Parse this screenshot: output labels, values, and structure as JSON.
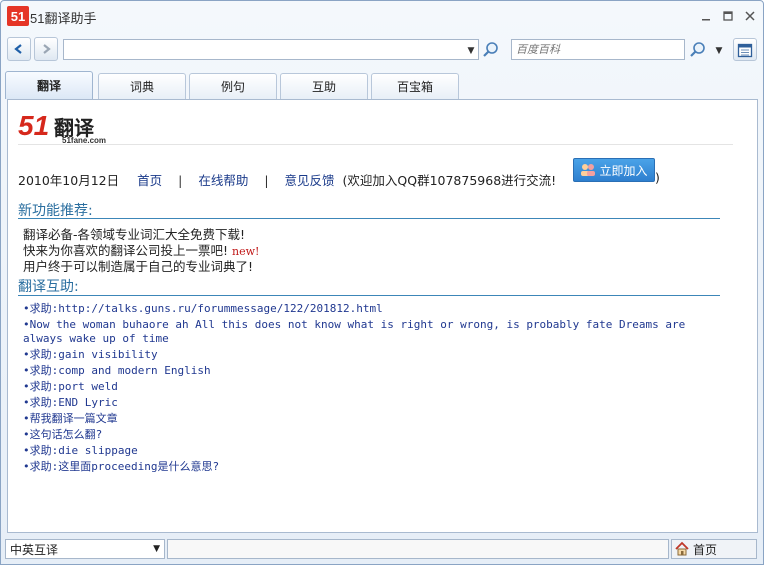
{
  "window": {
    "logo_text": "51",
    "title": "51翻译助手",
    "minimize_icon": "minimize-icon",
    "maximize_icon": "maximize-icon",
    "close_icon": "close-icon"
  },
  "toolbar": {
    "url_value": "",
    "search_placeholder": "百度百科"
  },
  "tabs": [
    {
      "label": "翻译",
      "active": true
    },
    {
      "label": "词典",
      "active": false
    },
    {
      "label": "例句",
      "active": false
    },
    {
      "label": "互助",
      "active": false
    },
    {
      "label": "百宝箱",
      "active": false
    }
  ],
  "brand": {
    "number": "51",
    "name": "翻译",
    "url": "51fane.com"
  },
  "info": {
    "date": "2010年10月12日",
    "home": "首页",
    "sep1": "|",
    "help": "在线帮助",
    "sep2": "|",
    "feedback": "意见反馈",
    "qq_text": "(欢迎加入QQ群107875968进行交流!",
    "join_button": "立即加入",
    "close_paren": ")"
  },
  "features": {
    "title": "新功能推荐:",
    "items": [
      "翻译必备-各领域专业词汇大全免费下载!",
      "快来为你喜欢的翻译公司投上一票吧!",
      "用户终于可以制造属于自己的专业词典了!"
    ],
    "new_tag": "new!"
  },
  "help": {
    "title": "翻译互助:",
    "items": [
      "•求助:http://talks.guns.ru/forummessage/122/201812.html",
      "•Now the woman buhaore ah All this does not know what is right or wrong, is probably fate Dreams are always wake up of time",
      "•求助:gain visibility",
      "•求助:comp and modern English",
      "•求助:port weld",
      "•求助:END Lyric",
      "•帮我翻译一篇文章",
      "•这句话怎么翻?",
      "•求助:die slippage",
      "•求助:这里面proceeding是什么意思?"
    ]
  },
  "statusbar": {
    "language": "中英互译",
    "home": "首页"
  },
  "colors": {
    "section_title": "#2b6fa0",
    "link": "#1a3a8a",
    "help_text": "#203890",
    "new_tag": "#c01818",
    "brand_red": "#d6281c"
  }
}
